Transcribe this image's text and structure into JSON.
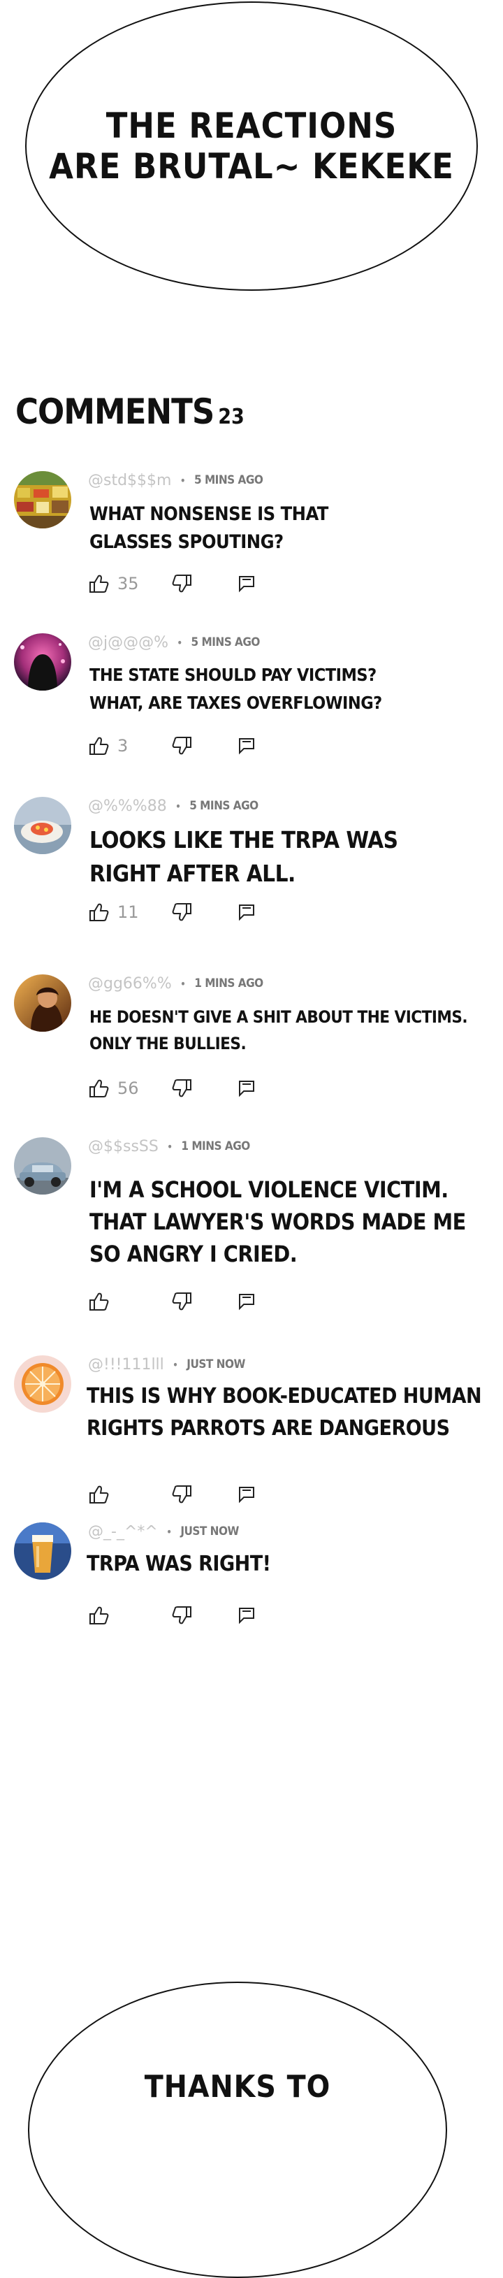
{
  "top_bubble": {
    "text": "THE REACTIONS\nARE BRUTAL~ KEKEKE"
  },
  "comments_header": {
    "title": "COMMENTS",
    "count": "23"
  },
  "comments": [
    {
      "handle": "@std$$$m",
      "time": "5 MINS AGO",
      "text": "WHAT NONSENSE IS THAT\nGLASSES SPOUTING?",
      "likes": "35",
      "avatar_icon": "market-avatar-icon"
    },
    {
      "handle": "@j@@@%",
      "time": "5 MINS AGO",
      "text": "THE STATE SHOULD PAY VICTIMS?\nWHAT, ARE TAXES OVERFLOWING?",
      "likes": "3",
      "avatar_icon": "hooded-figure-avatar-icon"
    },
    {
      "handle": "@%%%88",
      "time": "5 MINS AGO",
      "text": "LOOKS LIKE THE TRPA WAS\nRIGHT AFTER ALL.",
      "likes": "11",
      "avatar_icon": "food-avatar-icon"
    },
    {
      "handle": "@gg66%%",
      "time": "1 MINS AGO",
      "text": "HE DOESN'T GIVE A SHIT ABOUT THE VICTIMS.\nONLY THE BULLIES.",
      "likes": "56",
      "avatar_icon": "portrait-avatar-icon"
    },
    {
      "handle": "@$$ssSS",
      "time": "1 MINS AGO",
      "text": "I'M A SCHOOL VIOLENCE VICTIM.\nTHAT LAWYER'S WORDS MADE ME\nSO ANGRY I CRIED.",
      "likes": "",
      "avatar_icon": "car-avatar-icon"
    },
    {
      "handle": "@!!!111lll",
      "time": "JUST NOW",
      "text": "THIS IS WHY BOOK-EDUCATED HUMAN\nRIGHTS PARROTS ARE DANGEROUS",
      "likes": "",
      "avatar_icon": "orange-slice-avatar-icon"
    },
    {
      "handle": "@_-_^*^",
      "time": "JUST NOW",
      "text": "TRPA WAS RIGHT!",
      "likes": "",
      "avatar_icon": "beer-glass-avatar-icon"
    }
  ],
  "bottom_bubble": {
    "text": "THANKS TO"
  }
}
